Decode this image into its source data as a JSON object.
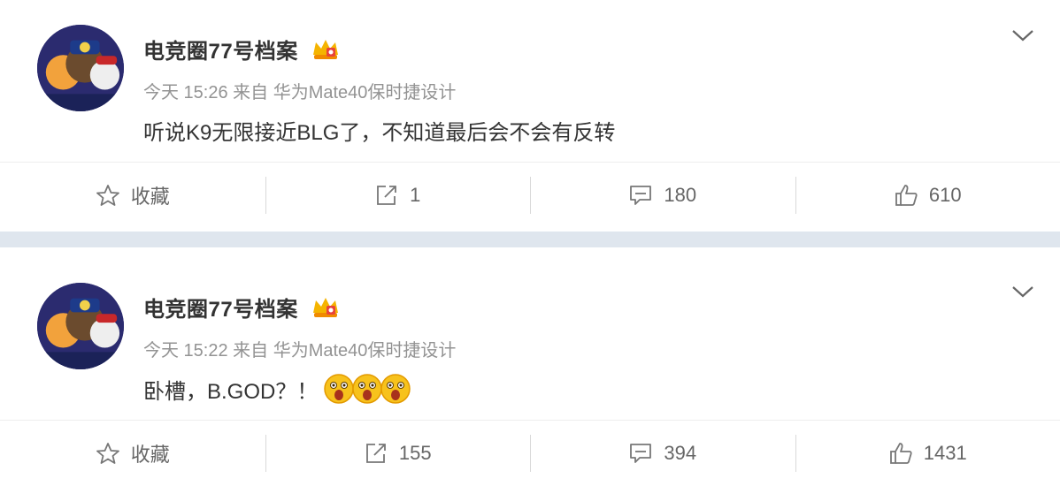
{
  "posts": [
    {
      "author": "电竞圈77号档案",
      "meta": "今天 15:26 来自 华为Mate40保时捷设计",
      "text": "听说K9无限接近BLG了，不知道最后会不会有反转",
      "actions": {
        "favorite": "收藏",
        "repost": "1",
        "comment": "180",
        "like": "610"
      }
    },
    {
      "author": "电竞圈77号档案",
      "meta": "今天 15:22 来自 华为Mate40保时捷设计",
      "text": "卧槽，B.GOD？！",
      "emoji_count": 3,
      "actions": {
        "favorite": "收藏",
        "repost": "155",
        "comment": "394",
        "like": "1431"
      }
    }
  ],
  "icons": [
    "avatar-image",
    "crown-badge-icon",
    "chevron-down-icon",
    "star-icon",
    "share-icon",
    "comment-icon",
    "thumbs-up-icon",
    "shocked-face-emoji"
  ]
}
